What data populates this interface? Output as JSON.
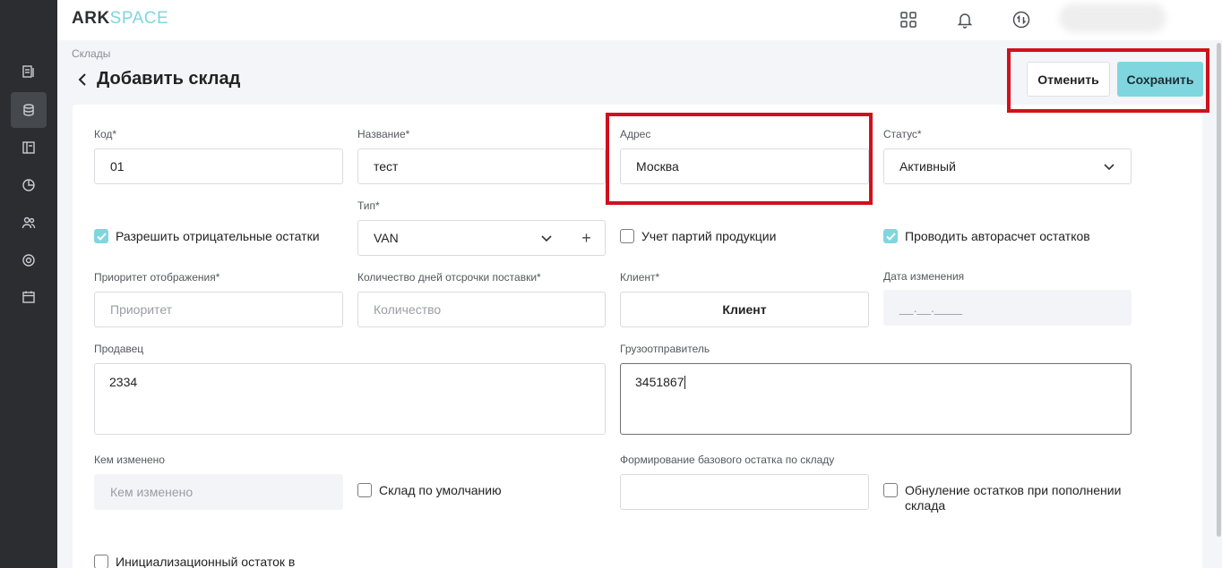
{
  "app": {
    "logo_ark": "ARK",
    "logo_space": "SPACE"
  },
  "sidebar": {
    "items": [
      "documents",
      "database",
      "catalog",
      "reports",
      "users",
      "settings",
      "calendar"
    ],
    "active": "database"
  },
  "header": {
    "icons": [
      "apps-grid-icon",
      "bell-icon",
      "sync-icon"
    ]
  },
  "page": {
    "breadcrumb": "Склады",
    "title": "Добавить склад",
    "cancel_label": "Отменить",
    "save_label": "Сохранить"
  },
  "form": {
    "code": {
      "label": "Код*",
      "value": "01"
    },
    "name": {
      "label": "Название*",
      "value": "тест"
    },
    "address": {
      "label": "Адрес",
      "value": "Москва"
    },
    "status": {
      "label": "Статус*",
      "value": "Активный"
    },
    "type": {
      "label": "Тип*",
      "value": "VAN",
      "add": "+"
    },
    "allow_negative": {
      "label": "Разрешить отрицательные остатки",
      "checked": true
    },
    "batch_tracking": {
      "label": "Учет партий продукции",
      "checked": false
    },
    "auto_calc": {
      "label": "Проводить авторасчет остатков",
      "checked": true
    },
    "priority": {
      "label": "Приоритет отображения*",
      "placeholder": "Приоритет"
    },
    "delay_days": {
      "label": "Количество дней отсрочки поставки*",
      "placeholder": "Количество"
    },
    "client": {
      "label": "Клиент*",
      "button": "Клиент"
    },
    "changed_date": {
      "label": "Дата изменения",
      "placeholder": "__.__.____"
    },
    "seller": {
      "label": "Продавец",
      "value": "2334"
    },
    "shipper": {
      "label": "Грузоотправитель",
      "value": "3451867"
    },
    "changed_by": {
      "label": "Кем изменено",
      "placeholder": "Кем изменено"
    },
    "default_warehouse": {
      "label": "Склад по умолчанию",
      "checked": false
    },
    "base_stock": {
      "label": "Формирование базового остатка по складу",
      "value": ""
    },
    "reset_on_refill": {
      "label": "Обнуление остатков при пополнении склада",
      "checked": false
    },
    "init_stock": {
      "label": "Инициализационный остаток в",
      "checked": false
    }
  },
  "colors": {
    "accent": "#7fd6df",
    "highlight": "#d0111b",
    "sidebar": "#2b2d30"
  }
}
